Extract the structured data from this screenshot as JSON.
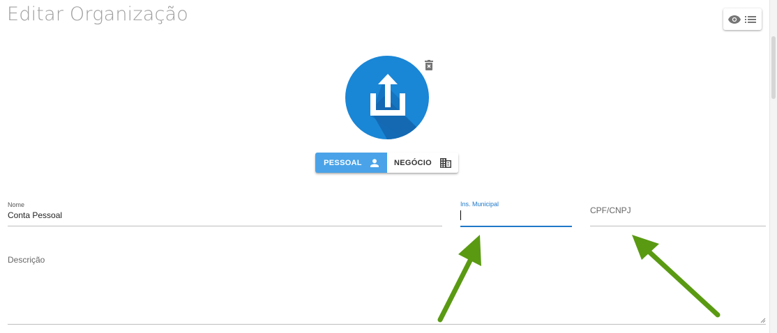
{
  "page": {
    "title": "Editar Organização"
  },
  "toolbar": {
    "view_icon": "eye-icon",
    "list_icon": "list-icon"
  },
  "avatar": {
    "icon": "upload-icon",
    "delete_icon": "trash-icon"
  },
  "account_type": {
    "options": [
      {
        "label": "PESSOAL",
        "icon": "person-icon",
        "selected": true
      },
      {
        "label": "NEGÓCIO",
        "icon": "business-icon",
        "selected": false
      }
    ]
  },
  "form": {
    "nome": {
      "label": "Nome",
      "value": "Conta Pessoal"
    },
    "ins_municipal": {
      "label": "Ins. Municipal",
      "value": ""
    },
    "cpf_cnpj": {
      "placeholder": "CPF/CNPJ",
      "value": ""
    },
    "descricao": {
      "placeholder": "Descrição",
      "value": ""
    }
  },
  "colors": {
    "accent": "#1f78c8",
    "toggle_active": "#4aa3e8",
    "avatar_bg": "#1a86d6",
    "annotation_arrow": "#5a9a12"
  }
}
